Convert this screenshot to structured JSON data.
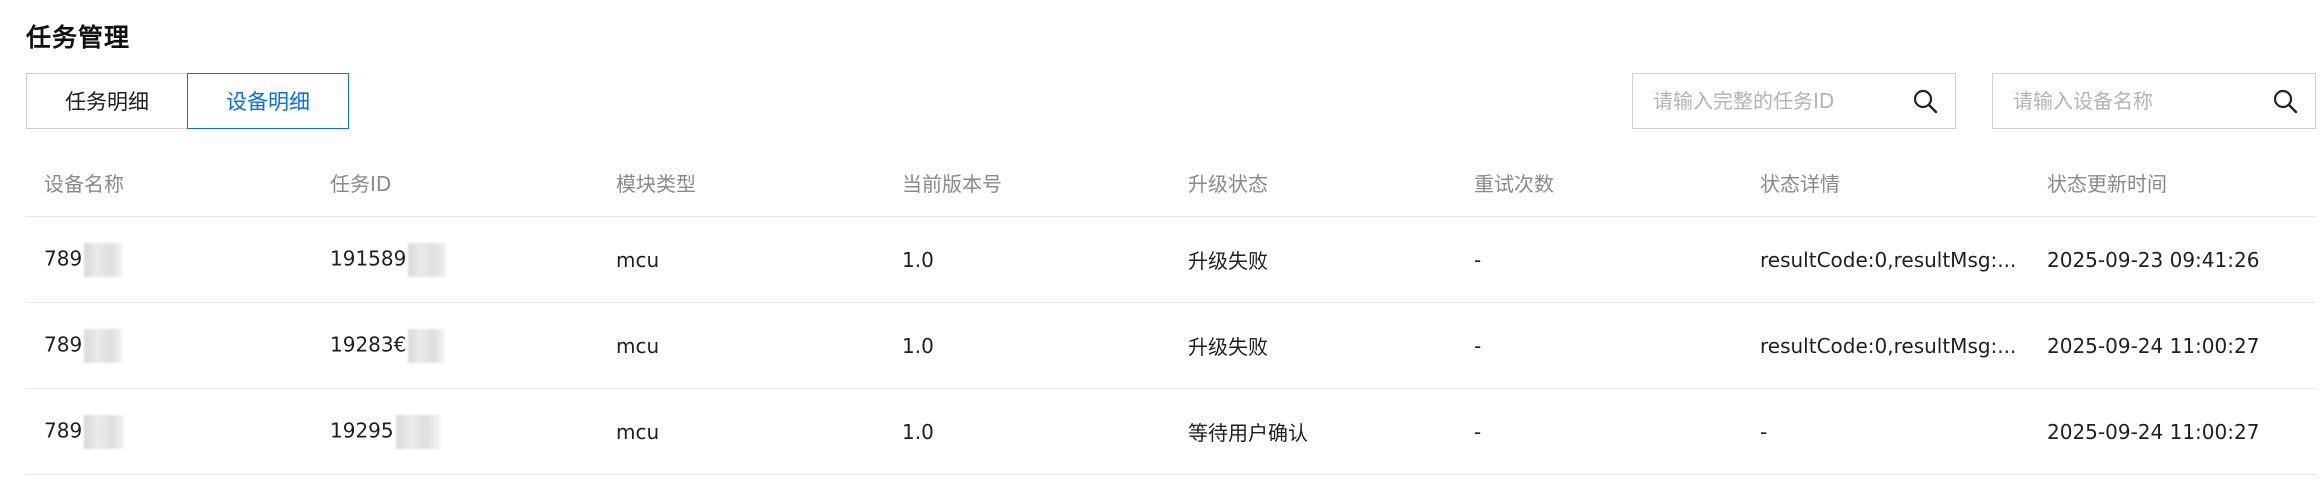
{
  "page": {
    "title": "任务管理"
  },
  "tabs": [
    {
      "label": "任务明细",
      "active": false
    },
    {
      "label": "设备明细",
      "active": true
    }
  ],
  "search": {
    "task_placeholder": "请输入完整的任务ID",
    "device_placeholder": "请输入设备名称",
    "icon": "search-icon"
  },
  "table": {
    "columns": [
      "设备名称",
      "任务ID",
      "模块类型",
      "当前版本号",
      "升级状态",
      "重试次数",
      "状态详情",
      "状态更新时间"
    ],
    "rows": [
      {
        "device": "789",
        "task_id": "191589",
        "module": "mcu",
        "version": "1.0",
        "status": "升级失败",
        "status_type": "fail",
        "retries": "-",
        "detail": "resultCode:0,resultMsg:...",
        "updated": "2025-09-23 09:41:26"
      },
      {
        "device": "789",
        "task_id": "19283€",
        "module": "mcu",
        "version": "1.0",
        "status": "升级失败",
        "status_type": "fail",
        "retries": "-",
        "detail": "resultCode:0,resultMsg:...",
        "updated": "2025-09-24 11:00:27"
      },
      {
        "device": "789",
        "task_id": "19295",
        "module": "mcu",
        "version": "1.0",
        "status": "等待用户确认",
        "status_type": "wait",
        "retries": "-",
        "detail": "-",
        "updated": "2025-09-24 11:00:27"
      }
    ]
  },
  "colors": {
    "accent": "#0a6cff",
    "fail": "#e5322d",
    "wait": "#0a8af0"
  }
}
